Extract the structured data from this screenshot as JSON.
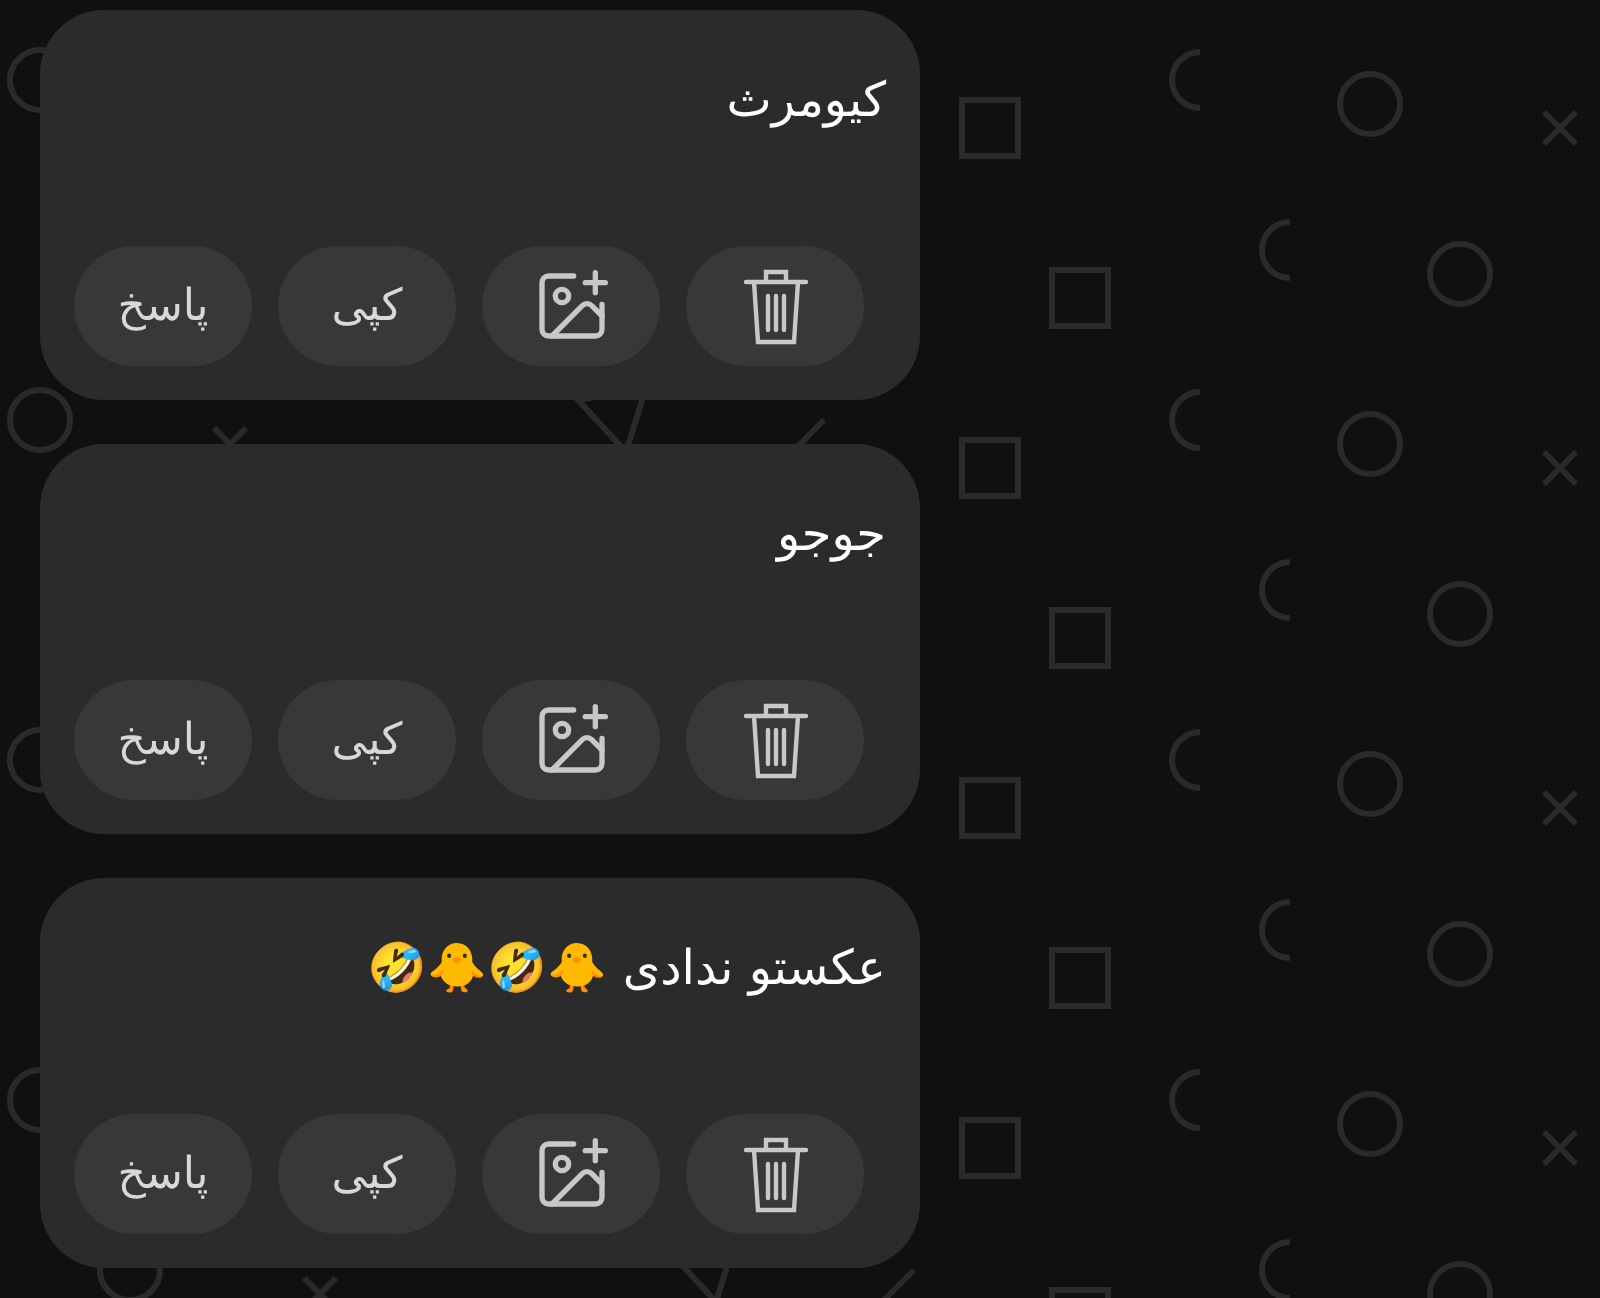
{
  "messages": [
    {
      "text": "کیومرث",
      "actions": [
        {
          "kind": "delete"
        },
        {
          "kind": "add-image"
        },
        {
          "kind": "copy",
          "label": "کپی"
        },
        {
          "kind": "reply",
          "label": "پاسخ"
        }
      ]
    },
    {
      "text": "جوجو",
      "actions": [
        {
          "kind": "delete"
        },
        {
          "kind": "add-image"
        },
        {
          "kind": "copy",
          "label": "کپی"
        },
        {
          "kind": "reply",
          "label": "پاسخ"
        }
      ]
    },
    {
      "text": "عکستو ندادی 🐥🤣🐥🤣",
      "actions": [
        {
          "kind": "delete"
        },
        {
          "kind": "add-image"
        },
        {
          "kind": "copy",
          "label": "کپی"
        },
        {
          "kind": "reply",
          "label": "پاسخ"
        }
      ]
    }
  ]
}
